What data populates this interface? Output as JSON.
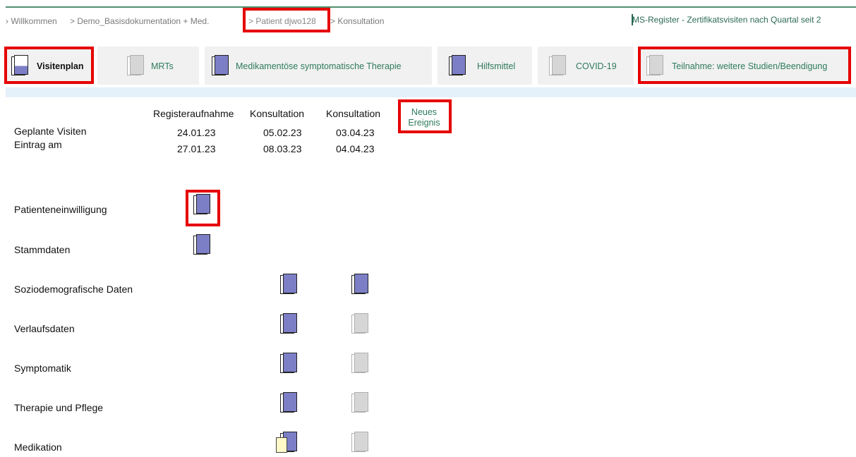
{
  "breadcrumb": {
    "items": [
      "› Willkommen",
      "> Demo_Basisdokumentation + Med.",
      "> Patient djwo128",
      "> Konsultation"
    ]
  },
  "register": {
    "title": "MS-Register - Zertifikatsvisiten nach Quartal seit 2"
  },
  "tabs": [
    {
      "label": "Visitenplan",
      "icon": "book-icon",
      "state": "blue-half"
    },
    {
      "label": "MRTs",
      "icon": "book-icon",
      "state": "gray"
    },
    {
      "label": "Medikamentöse symptomatische Therapie",
      "icon": "book-icon",
      "state": "blue"
    },
    {
      "label": "Hilfsmittel",
      "icon": "book-icon",
      "state": "blue"
    },
    {
      "label": "COVID-19",
      "icon": "book-icon",
      "state": "gray"
    },
    {
      "label": "Teilnahme: weitere Studien/Beendigung",
      "icon": "book-icon",
      "state": "gray"
    }
  ],
  "visits": {
    "row_labels": [
      "Geplante Visiten",
      "Eintrag am"
    ],
    "columns": [
      {
        "title": "Registeraufnahme",
        "planned": "24.01.23",
        "entered": "27.01.23"
      },
      {
        "title": "Konsultation",
        "planned": "05.02.23",
        "entered": "08.03.23"
      },
      {
        "title": "Konsultation",
        "planned": "03.04.23",
        "entered": "04.04.23"
      }
    ],
    "new_event": "Neues\nEreignis"
  },
  "forms": [
    {
      "label": "Patienteneinwilligung",
      "cells": [
        "blue",
        null,
        null
      ]
    },
    {
      "label": "Stammdaten",
      "cells": [
        "blue",
        null,
        null
      ]
    },
    {
      "label": "Soziodemografische Daten",
      "cells": [
        null,
        "blue",
        "blue"
      ]
    },
    {
      "label": "Verlaufsdaten",
      "cells": [
        null,
        "blue",
        "gray"
      ]
    },
    {
      "label": "Symptomatik",
      "cells": [
        null,
        "blue",
        "gray"
      ]
    },
    {
      "label": "Therapie und Pflege",
      "cells": [
        null,
        "blue",
        "gray"
      ]
    },
    {
      "label": "Medikation",
      "cells": [
        null,
        "blue-page",
        "gray"
      ]
    }
  ],
  "colors": {
    "accent": "#2e7a5c",
    "book_blue": "#7c7fc6",
    "book_gray": "#d6d6d6",
    "highlight": "#e60000"
  }
}
